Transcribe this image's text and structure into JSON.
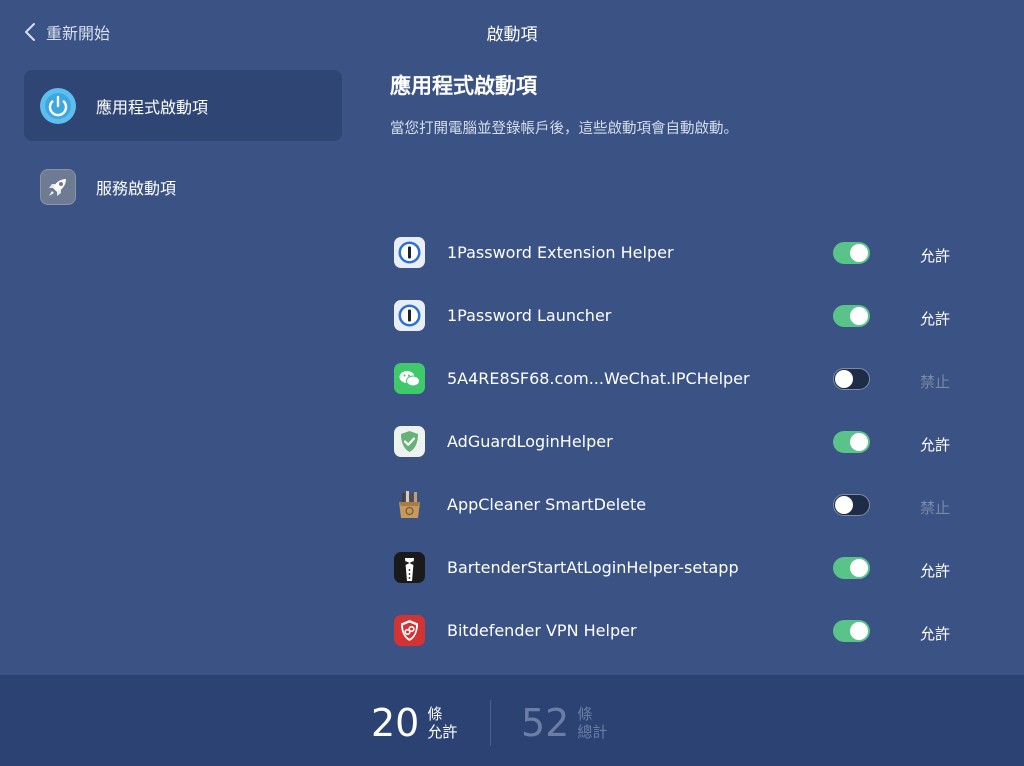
{
  "header": {
    "back_label": "重新開始",
    "title": "啟動項"
  },
  "sidebar": {
    "items": [
      {
        "label": "應用程式啟動項",
        "icon": "power-icon",
        "active": true
      },
      {
        "label": "服務啟動項",
        "icon": "rocket-icon",
        "active": false
      }
    ]
  },
  "main": {
    "title": "應用程式啟動項",
    "subtitle": "當您打開電腦並登錄帳戶後，這些啟動項會自動啟動。",
    "items": [
      {
        "name": "1Password Extension Helper",
        "icon": "1password-icon",
        "enabled": true,
        "status": "允許"
      },
      {
        "name": "1Password Launcher",
        "icon": "1password-icon",
        "enabled": true,
        "status": "允許"
      },
      {
        "name": "5A4RE8SF68.com...WeChat.IPCHelper",
        "icon": "wechat-icon",
        "enabled": false,
        "status": "禁止"
      },
      {
        "name": "AdGuardLoginHelper",
        "icon": "adguard-shield-icon",
        "enabled": true,
        "status": "允許"
      },
      {
        "name": "AppCleaner SmartDelete",
        "icon": "appcleaner-box-icon",
        "enabled": false,
        "status": "禁止"
      },
      {
        "name": "BartenderStartAtLoginHelper-setapp",
        "icon": "bartender-tuxedo-icon",
        "enabled": true,
        "status": "允許"
      },
      {
        "name": "Bitdefender VPN Helper",
        "icon": "bitdefender-shield-icon",
        "enabled": true,
        "status": "允許"
      }
    ]
  },
  "footer": {
    "allowed_count": "20",
    "allowed_unit_top": "條",
    "allowed_unit_bottom": "允許",
    "total_count": "52",
    "total_unit_top": "條",
    "total_unit_bottom": "總計"
  },
  "colors": {
    "background": "#3a5284",
    "sidebar_active": "#2f4675",
    "footer": "#2b4273",
    "toggle_on": "#59c38a",
    "toggle_off": "#1f2c47"
  }
}
